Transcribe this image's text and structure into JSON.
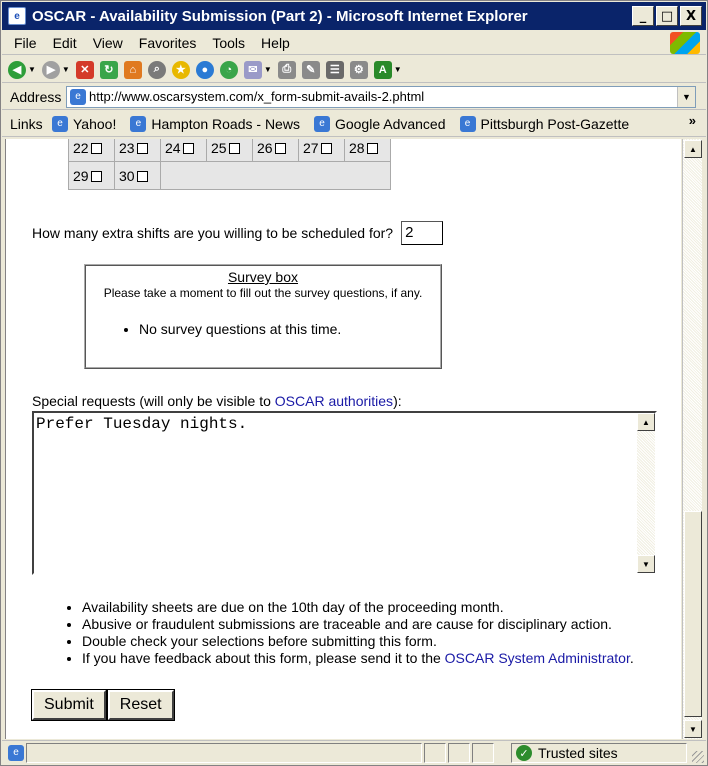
{
  "window": {
    "title": "OSCAR - Availability Submission (Part 2) - Microsoft Internet Explorer",
    "controls": [
      "_",
      "□",
      "X"
    ]
  },
  "menu": {
    "items": [
      "File",
      "Edit",
      "View",
      "Favorites",
      "Tools",
      "Help"
    ]
  },
  "address": {
    "label": "Address",
    "url": "http://www.oscarsystem.com/x_form-submit-avails-2.phtml"
  },
  "links": {
    "label": "Links",
    "items": [
      "Yahoo!",
      "Hampton Roads - News",
      "Google Advanced",
      "Pittsburgh Post-Gazette"
    ],
    "more": "»"
  },
  "calendar": {
    "partial_row": [
      "22",
      "23",
      "24",
      "25",
      "26",
      "27",
      "28"
    ],
    "last_row": [
      "29",
      "30"
    ]
  },
  "shifts": {
    "question": "How many extra shifts are you willing to be scheduled for?",
    "value": "2"
  },
  "survey": {
    "title": "Survey box",
    "prompt": "Please take a moment to fill out the survey questions, if any.",
    "items": [
      "No survey questions at this time."
    ]
  },
  "special": {
    "label_prefix": "Special requests (will only be visible to ",
    "link": "OSCAR authorities",
    "label_suffix": "):",
    "value": "Prefer Tuesday nights."
  },
  "notes": {
    "items": [
      "Availability sheets are due on the 10th day of the proceeding month.",
      "Abusive or fraudulent submissions are traceable and are cause for disciplinary action.",
      "Double check your selections before submitting this form."
    ],
    "feedback_prefix": "If you have feedback about this form, please send it to the ",
    "feedback_link": "OSCAR System Administrator",
    "feedback_suffix": "."
  },
  "buttons": {
    "submit": "Submit",
    "reset": "Reset"
  },
  "status": {
    "zone": "Trusted sites"
  }
}
